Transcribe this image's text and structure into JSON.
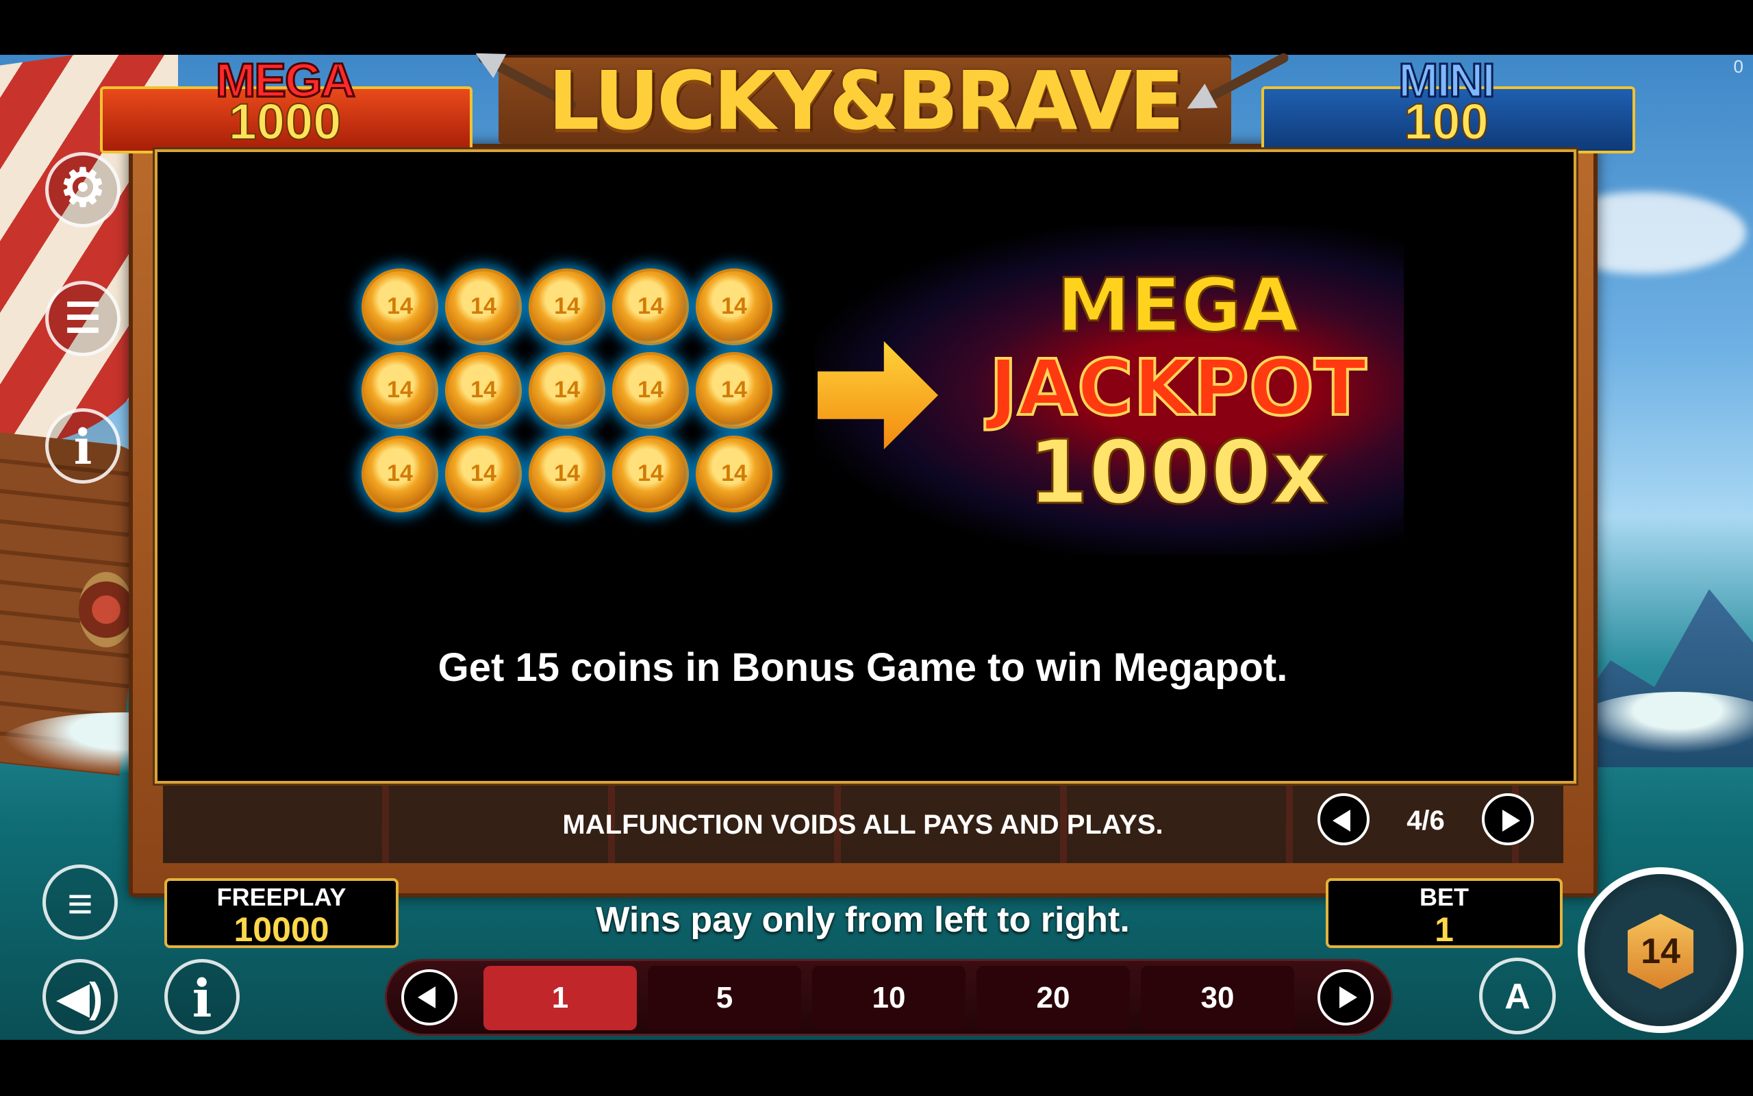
{
  "game": {
    "title": "LUCKY&BRAVE"
  },
  "jackpots": {
    "mega": {
      "label": "MEGA",
      "value": "1000"
    },
    "mini": {
      "label": "MINI",
      "value": "100"
    }
  },
  "corner_counter": "0",
  "sidebar": {
    "settings_icon": "gear-icon",
    "coins_icon": "coin-stack-icon",
    "info_icon": "info-icon",
    "menu_icon": "menu-icon",
    "sound_icon": "speaker-icon",
    "info_bottom_icon": "info-icon"
  },
  "help_page": {
    "jackpot_lines": [
      "MEGA",
      "JACKPOT",
      "1000x"
    ],
    "coin_count": 15,
    "description": "Get 15 coins in Bonus Game to win Megapot."
  },
  "footer_notice": "MALFUNCTION VOIDS ALL PAYS AND PLAYS.",
  "pagination": {
    "current": 4,
    "total": 6,
    "text": "4/6"
  },
  "freeplay": {
    "label": "FREEPLAY",
    "value": "10000"
  },
  "bet": {
    "label": "BET",
    "value": "1"
  },
  "wins_text": "Wins pay only from left to right.",
  "bet_options": [
    {
      "label": "1",
      "active": true
    },
    {
      "label": "5",
      "active": false
    },
    {
      "label": "10",
      "active": false
    },
    {
      "label": "20",
      "active": false
    },
    {
      "label": "30",
      "active": false
    }
  ],
  "autoplay_label": "A",
  "spin_label": "14",
  "colors": {
    "gold": "#ffd21e",
    "mega_red": "#ff3a10",
    "active_bet": "#c0262a",
    "frame_gold": "#e3b33c"
  }
}
